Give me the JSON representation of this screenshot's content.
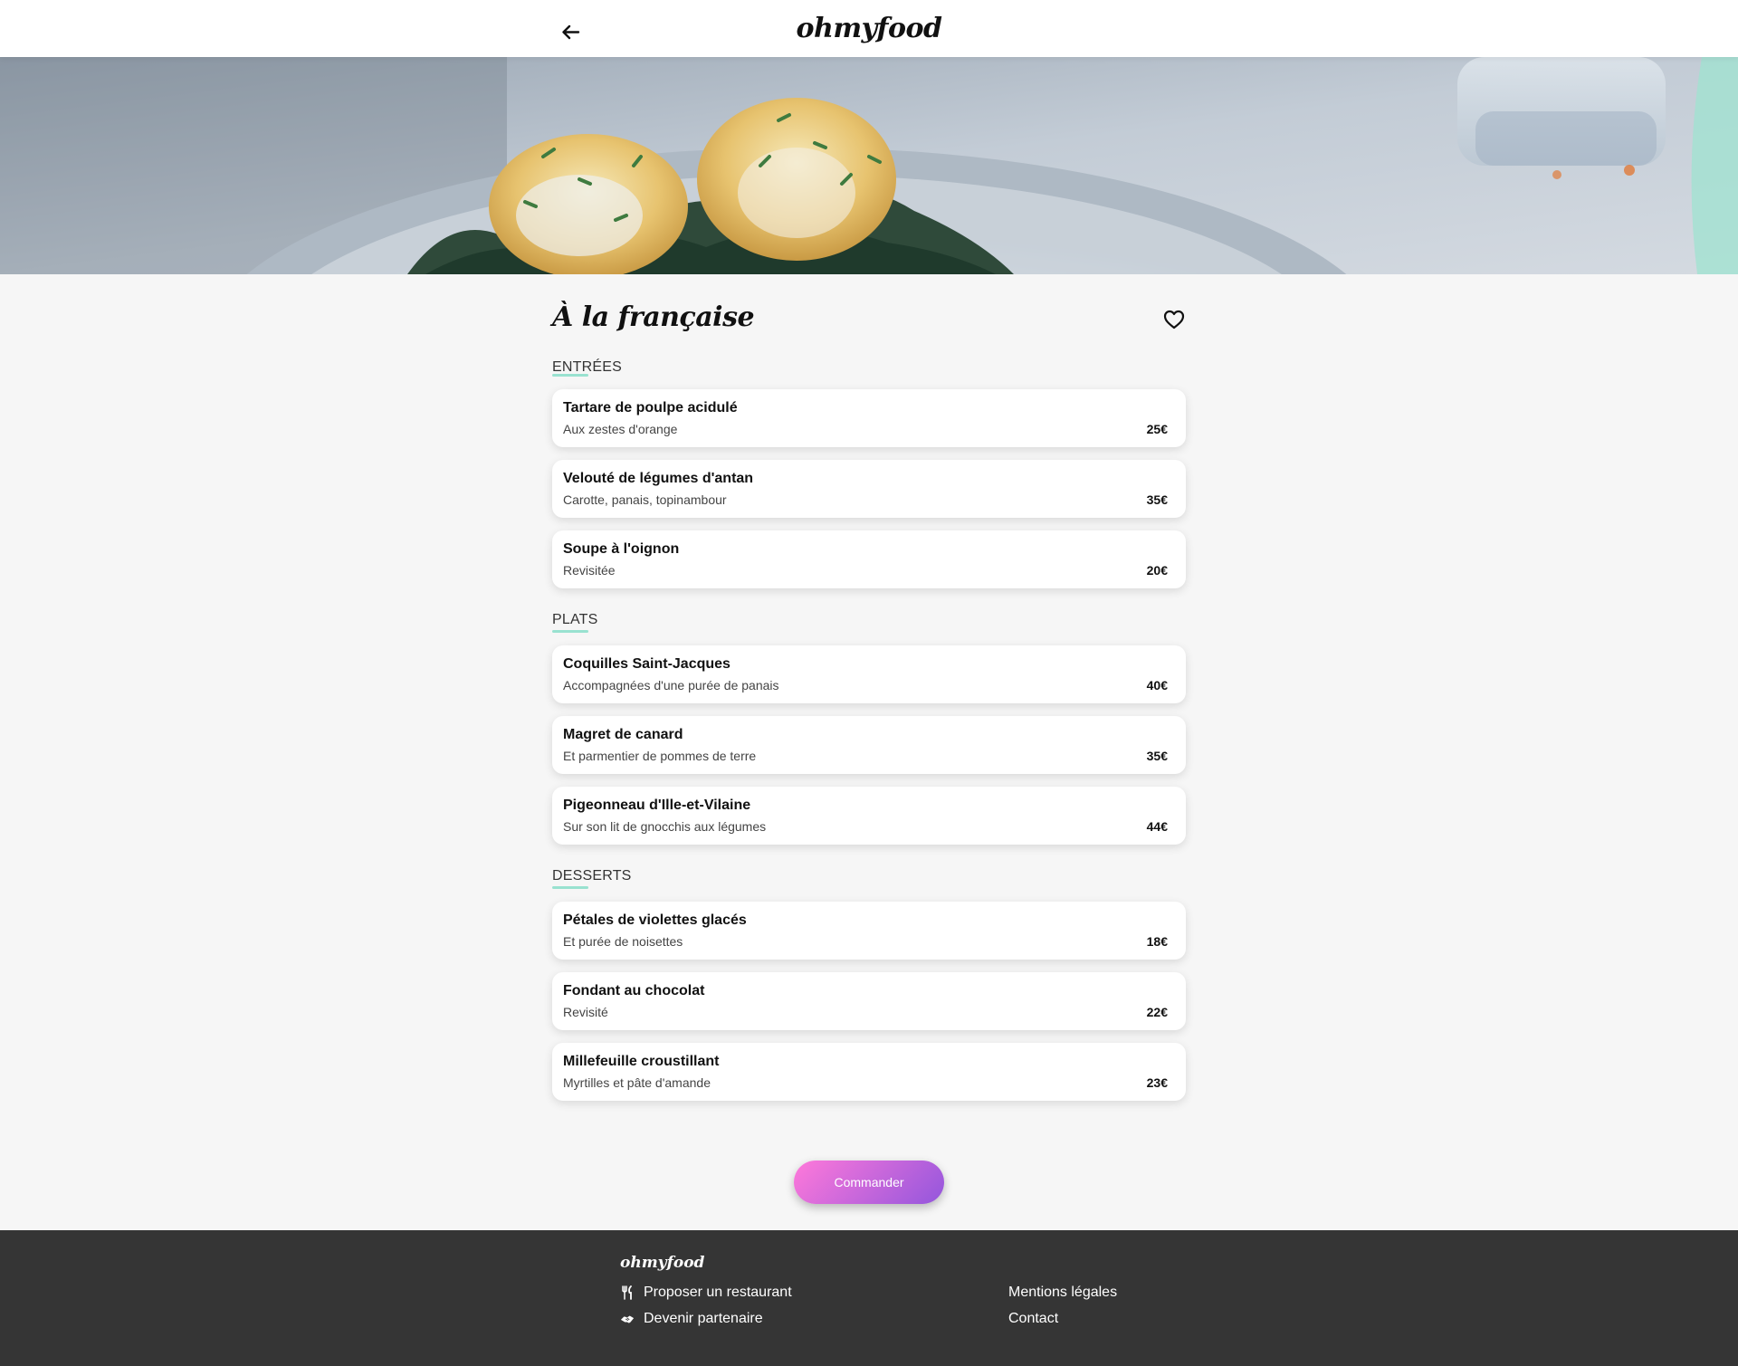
{
  "header": {
    "logo": "ohmyfood"
  },
  "restaurant": {
    "name": "À la française"
  },
  "menu": {
    "sections": [
      {
        "title": "ENTRÉES",
        "dishes": [
          {
            "name": "Tartare de poulpe acidulé",
            "description": "Aux zestes d'orange",
            "price": "25€"
          },
          {
            "name": "Velouté de légumes d'antan",
            "description": "Carotte, panais, topinambour",
            "price": "35€"
          },
          {
            "name": "Soupe à l'oignon",
            "description": "Revisitée",
            "price": "20€"
          }
        ]
      },
      {
        "title": "PLATS",
        "dishes": [
          {
            "name": "Coquilles Saint-Jacques",
            "description": "Accompagnées d'une purée de panais",
            "price": "40€"
          },
          {
            "name": "Magret de canard",
            "description": "Et parmentier de pommes de terre",
            "price": "35€"
          },
          {
            "name": "Pigeonneau d'Ille-et-Vilaine",
            "description": "Sur son lit de gnocchis aux légumes",
            "price": "44€"
          }
        ]
      },
      {
        "title": "DESSERTS",
        "dishes": [
          {
            "name": "Pétales de violettes glacés",
            "description": "Et purée de noisettes",
            "price": "18€"
          },
          {
            "name": "Fondant au chocolat",
            "description": "Revisité",
            "price": "22€"
          },
          {
            "name": "Millefeuille croustillant",
            "description": "Myrtilles et pâte d'amande",
            "price": "23€"
          }
        ]
      }
    ]
  },
  "order_button": "Commander",
  "footer": {
    "logo": "ohmyfood",
    "links_left": [
      {
        "label": "Proposer un restaurant",
        "icon": "utensils-icon"
      },
      {
        "label": "Devenir partenaire",
        "icon": "handshake-icon"
      }
    ],
    "links_right": [
      {
        "label": "Mentions légales"
      },
      {
        "label": "Contact"
      }
    ]
  },
  "colors": {
    "accent_underline": "#99e2d0",
    "button_gradient_start": "#ff79da",
    "button_gradient_end": "#9356dc",
    "footer_bg": "#353535",
    "page_bg": "#f6f6f6"
  }
}
